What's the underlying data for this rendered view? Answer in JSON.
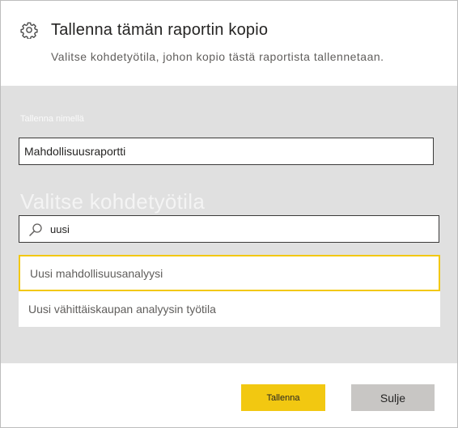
{
  "dialog": {
    "title": "Tallenna tämän raportin kopio",
    "subtitle": "Valitse kohdetyötila, johon kopio tästä raportista tallennetaan.",
    "icon": "gear-icon"
  },
  "form": {
    "name_label": "Tallenna nimellä",
    "name_value": "Mahdollisuusraportti",
    "workspace_heading": "Valitse kohdetyötila",
    "search_value": "uusi",
    "search_icon": "search-icon"
  },
  "workspaces": [
    {
      "label": "Uusi mahdollisuusanalyysi",
      "selected": true
    },
    {
      "label": "Uusi vähittäiskaupan analyysin työtila",
      "selected": false
    }
  ],
  "footer": {
    "save_label": "Tallenna",
    "close_label": "Sulje"
  },
  "colors": {
    "accent": "#F2C811",
    "panel_bg": "#E0E0E0",
    "secondary_button": "#C8C6C4"
  }
}
